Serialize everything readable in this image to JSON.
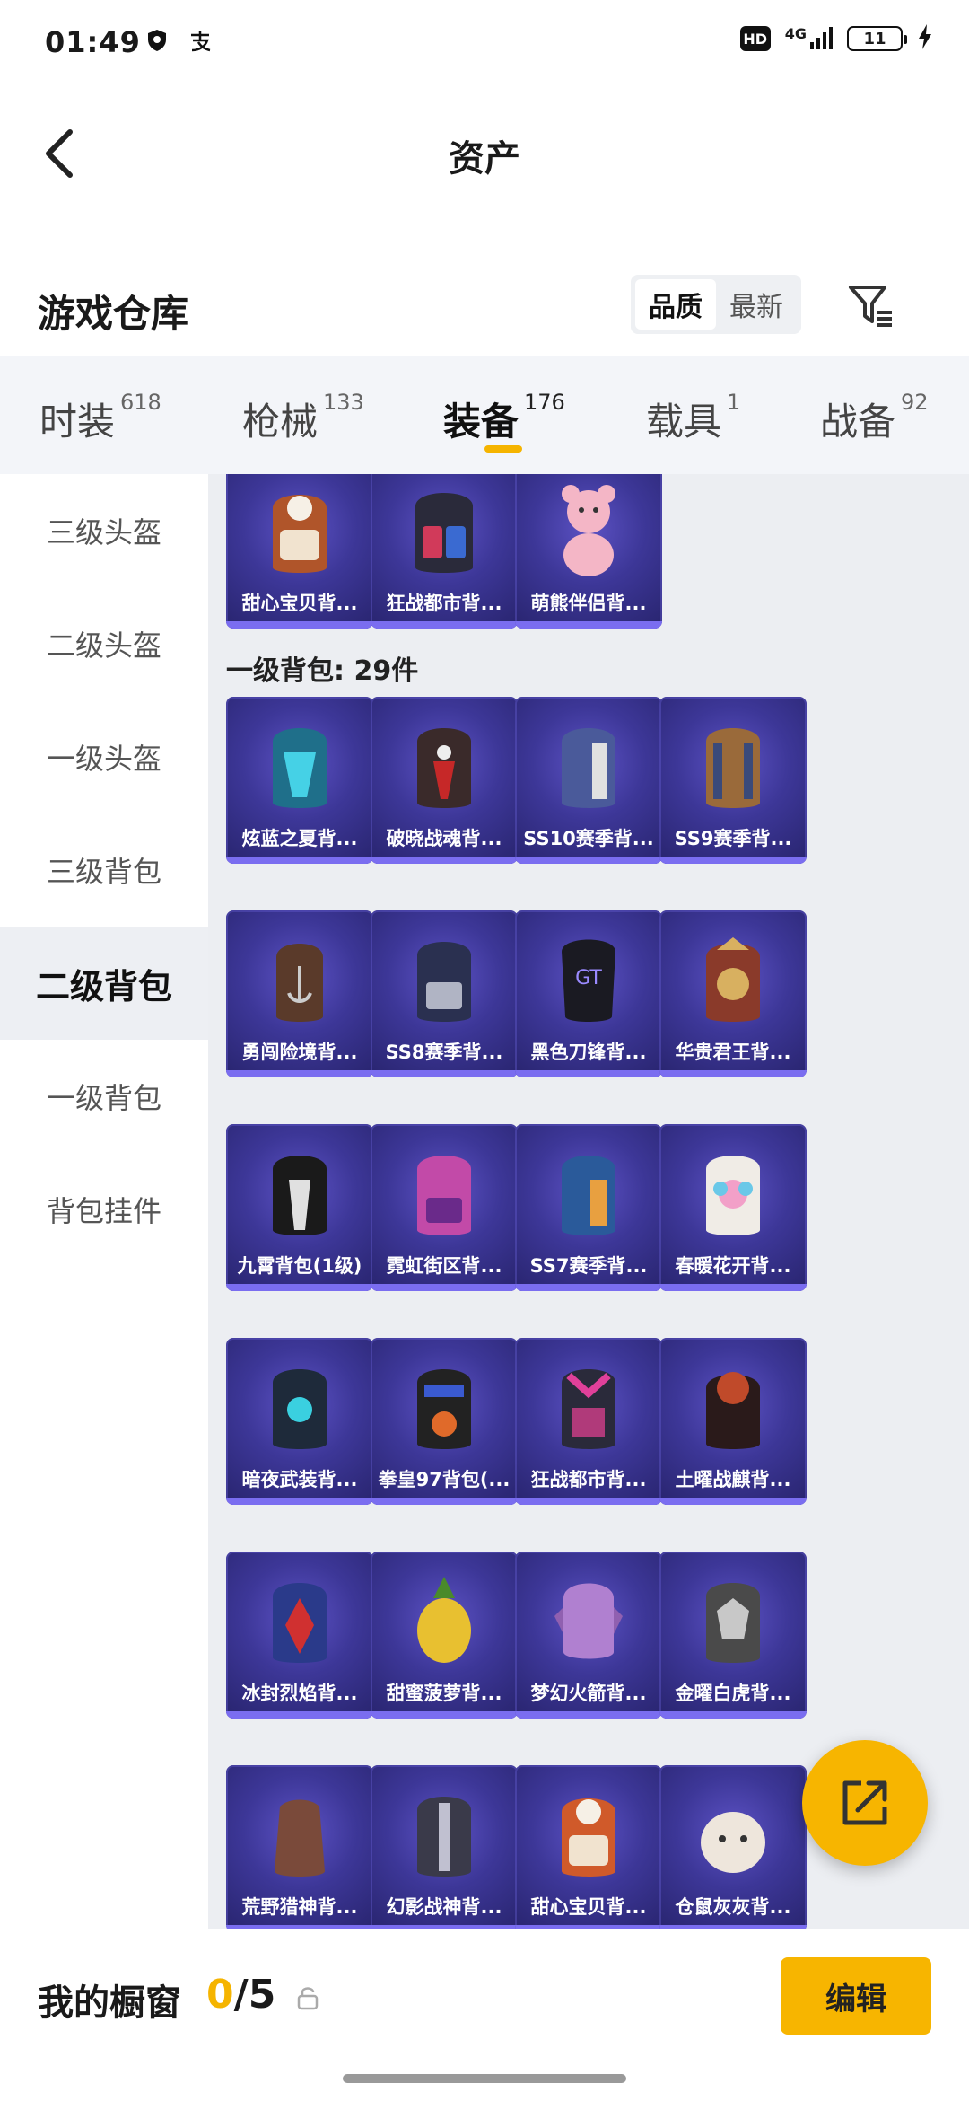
{
  "status_bar": {
    "time": "01:49",
    "network": "4G",
    "battery": "11"
  },
  "header": {
    "title": "资产"
  },
  "warehouse": {
    "title": "游戏仓库",
    "sort_options": [
      "品质",
      "最新"
    ],
    "active_sort": "品质"
  },
  "tabs": [
    {
      "label": "时装",
      "count": "618"
    },
    {
      "label": "枪械",
      "count": "133"
    },
    {
      "label": "装备",
      "count": "176"
    },
    {
      "label": "载具",
      "count": "1"
    },
    {
      "label": "战备",
      "count": "92"
    }
  ],
  "sidebar": {
    "items": [
      "三级头盔",
      "二级头盔",
      "一级头盔",
      "三级背包",
      "二级背包",
      "一级背包",
      "背包挂件"
    ],
    "active": "二级背包"
  },
  "content": {
    "top_row": [
      "甜心宝贝背...",
      "狂战都市背...",
      "萌熊伴侣背..."
    ],
    "section_label": "一级背包: 29件",
    "grid": [
      [
        "炫蓝之夏背...",
        "破晓战魂背...",
        "SS10赛季背...",
        "SS9赛季背..."
      ],
      [
        "勇闯险境背...",
        "SS8赛季背...",
        "黑色刀锋背...",
        "华贵君王背..."
      ],
      [
        "九霄背包(1级)",
        "霓虹街区背...",
        "SS7赛季背...",
        "春暖花开背..."
      ],
      [
        "暗夜武装背...",
        "拳皇97背包(...",
        "狂战都市背...",
        "土曜战麒背..."
      ],
      [
        "冰封烈焰背...",
        "甜蜜菠萝背...",
        "梦幻火箭背...",
        "金曜白虎背..."
      ],
      [
        "荒野猎神背...",
        "幻影战神背...",
        "甜心宝贝背...",
        "仓鼠灰灰背..."
      ]
    ]
  },
  "bottom_bar": {
    "showcase_label": "我的橱窗",
    "showcase_used": "0",
    "showcase_total": "/5",
    "edit_label": "编辑"
  },
  "colors": {
    "accent": "#f7b500",
    "card_bg": "#3d3798"
  }
}
